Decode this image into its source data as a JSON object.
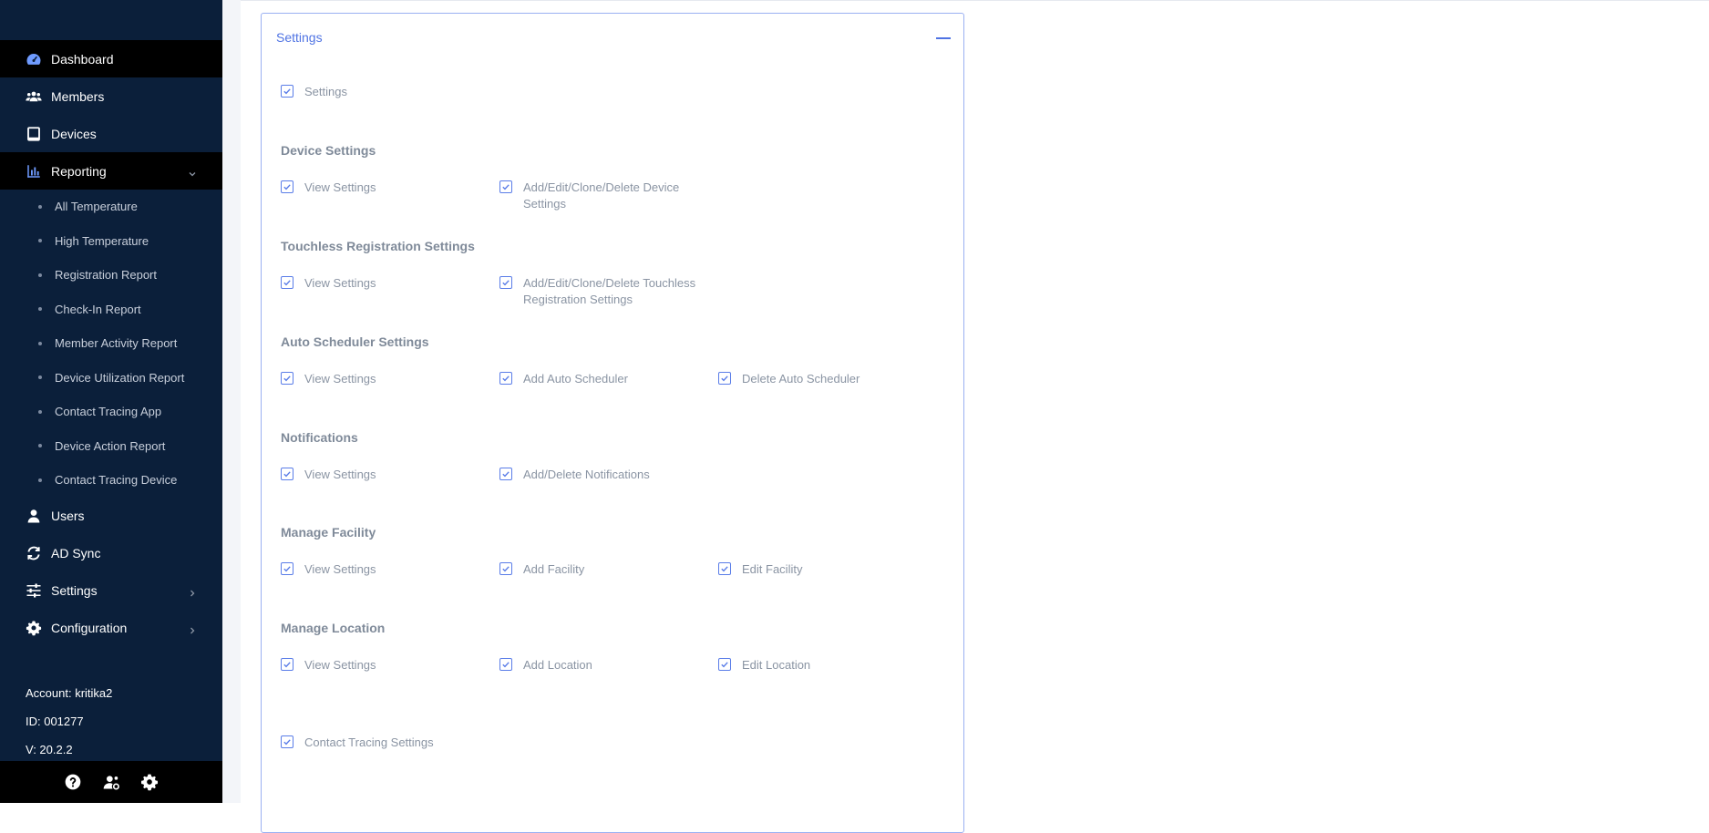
{
  "sidebar": {
    "nav": [
      {
        "label": "Dashboard",
        "icon": "dashboard-icon",
        "active": true
      },
      {
        "label": "Members",
        "icon": "members-icon"
      },
      {
        "label": "Devices",
        "icon": "device-icon"
      },
      {
        "label": "Reporting",
        "icon": "reporting-icon",
        "active": true,
        "expanded": true
      }
    ],
    "reporting_items": [
      "All Temperature",
      "High Temperature",
      "Registration Report",
      "Check-In Report",
      "Member Activity Report",
      "Device Utilization Report",
      "Contact Tracing App",
      "Device Action Report",
      "Contact Tracing Device"
    ],
    "nav_bottom": [
      {
        "label": "Users",
        "icon": "user-icon"
      },
      {
        "label": "AD Sync",
        "icon": "sync-icon"
      },
      {
        "label": "Settings",
        "icon": "sliders-icon",
        "has_children": true
      },
      {
        "label": "Configuration",
        "icon": "gear-icon",
        "has_children": true
      }
    ],
    "account": "Account: kritika2",
    "id": "ID: 001277",
    "version": "V: 20.2.2",
    "bottom_icons": [
      "help-icon",
      "user-settings-icon",
      "gear-icon"
    ]
  },
  "panel": {
    "title": "Settings",
    "top_checkbox": "Settings",
    "sections": [
      {
        "title": "Device Settings",
        "items": [
          "View Settings",
          "Add/Edit/Clone/Delete Device Settings"
        ]
      },
      {
        "title": "Touchless Registration Settings",
        "items": [
          "View Settings",
          "Add/Edit/Clone/Delete Touchless Registration Settings"
        ]
      },
      {
        "title": "Auto Scheduler Settings",
        "items": [
          "View Settings",
          "Add Auto Scheduler",
          "Delete Auto Scheduler"
        ]
      },
      {
        "title": "Notifications",
        "items": [
          "View Settings",
          "Add/Delete Notifications"
        ]
      },
      {
        "title": "Manage Facility",
        "items": [
          "View Settings",
          "Add Facility",
          "Edit Facility"
        ]
      },
      {
        "title": "Manage Location",
        "items": [
          "View Settings",
          "Add Location",
          "Edit Location"
        ]
      }
    ],
    "bottom_checkbox": "Contact Tracing Settings"
  },
  "colors": {
    "sidebar_bg": "#0b1f3a",
    "active_bg": "#000000",
    "accent": "#4f73e3",
    "section_text": "#7f8a99",
    "label_text": "#8a94a3"
  }
}
